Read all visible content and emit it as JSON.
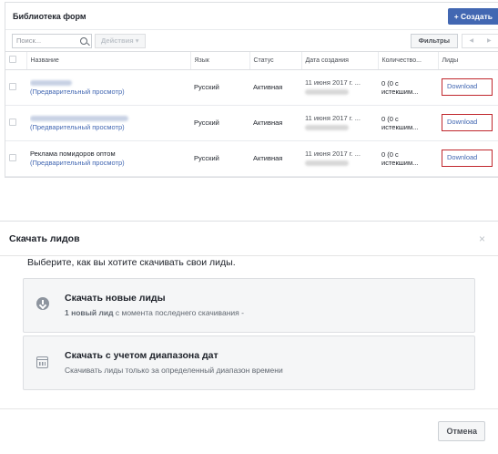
{
  "library": {
    "title": "Библиотека форм",
    "create_label": "+ Создать",
    "search_placeholder": "Поиск...",
    "actions_label": "Действия ▾",
    "filters_label": "Фильтры",
    "pager_prev": "◀",
    "pager_next": "▶",
    "columns": [
      "Название",
      "Язык",
      "Статус",
      "Дата создания",
      "Количество...",
      "Лиды"
    ],
    "rows": [
      {
        "name": "",
        "preview": "(Предварительный просмотр)",
        "language": "Русский",
        "status": "Активная",
        "date": "11 июня 2017 г. ...",
        "qty_line1": "0 (0 с",
        "qty_line2": "истекшим...",
        "leads": "Download"
      },
      {
        "name": "",
        "preview": "(Предварительный просмотр)",
        "language": "Русский",
        "status": "Активная",
        "date": "11 июня 2017 г. ...",
        "qty_line1": "0 (0 с",
        "qty_line2": "истекшим...",
        "leads": "Download"
      },
      {
        "name": "Реклама помидоров оптом",
        "preview": "(Предварительный просмотр)",
        "language": "Русский",
        "status": "Активная",
        "date": "11 июня 2017 г. ...",
        "qty_line1": "0 (0 с",
        "qty_line2": "истекшим...",
        "leads": "Download"
      }
    ],
    "colors": {
      "accent": "#4267b2",
      "highlight_border": "#c0272d"
    }
  },
  "modal": {
    "title": "Скачать лидов",
    "close": "×",
    "subtitle": "Выберите, как вы хотите скачивать свои лиды.",
    "option_new": {
      "title": "Скачать новые лиды",
      "desc_bold": "1 новый лид",
      "desc_rest": " с момента последнего скачивания -",
      "icon": "download-circle-icon"
    },
    "option_range": {
      "title": "Скачать с учетом диапазона дат",
      "desc": "Скачивать лиды только за определенный диапазон времени",
      "icon": "calendar-icon"
    },
    "cancel_label": "Отмена"
  }
}
